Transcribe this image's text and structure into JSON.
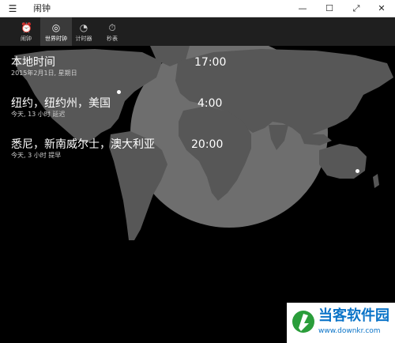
{
  "window": {
    "title": "闹钟",
    "menu_icon": "hamburger-icon",
    "controls": {
      "minimize": "—",
      "maximize": "☐",
      "fullscreen": "⤢",
      "close": "✕"
    }
  },
  "nav": {
    "tabs": [
      {
        "label": "闹钟",
        "icon": "alarm-icon",
        "active": false
      },
      {
        "label": "世界时钟",
        "icon": "world-clock-icon",
        "active": true
      },
      {
        "label": "计时器",
        "icon": "timer-icon",
        "active": false
      },
      {
        "label": "秒表",
        "icon": "stopwatch-icon",
        "active": false
      }
    ]
  },
  "clocks": [
    {
      "city": "本地时间",
      "detail": "2015年2月1日, 星期日",
      "time": "17:00"
    },
    {
      "city": "纽约，纽约州，美国",
      "detail": "今天, 13 小时 延迟",
      "time": "4:00"
    },
    {
      "city": "悉尼，新南威尔士，澳大利亚",
      "detail": "今天, 3 小时 提早",
      "time": "20:00"
    }
  ],
  "watermark": {
    "title": "当客软件园",
    "url": "www.downkr.com"
  },
  "colors": {
    "titlebar": "#ffffff",
    "nav": "#1f1f1f",
    "tab_active": "#3a3a3a",
    "map_land": "#5a5a5a",
    "daylight": "#7a7a7a",
    "brand": "#0b74c8"
  }
}
